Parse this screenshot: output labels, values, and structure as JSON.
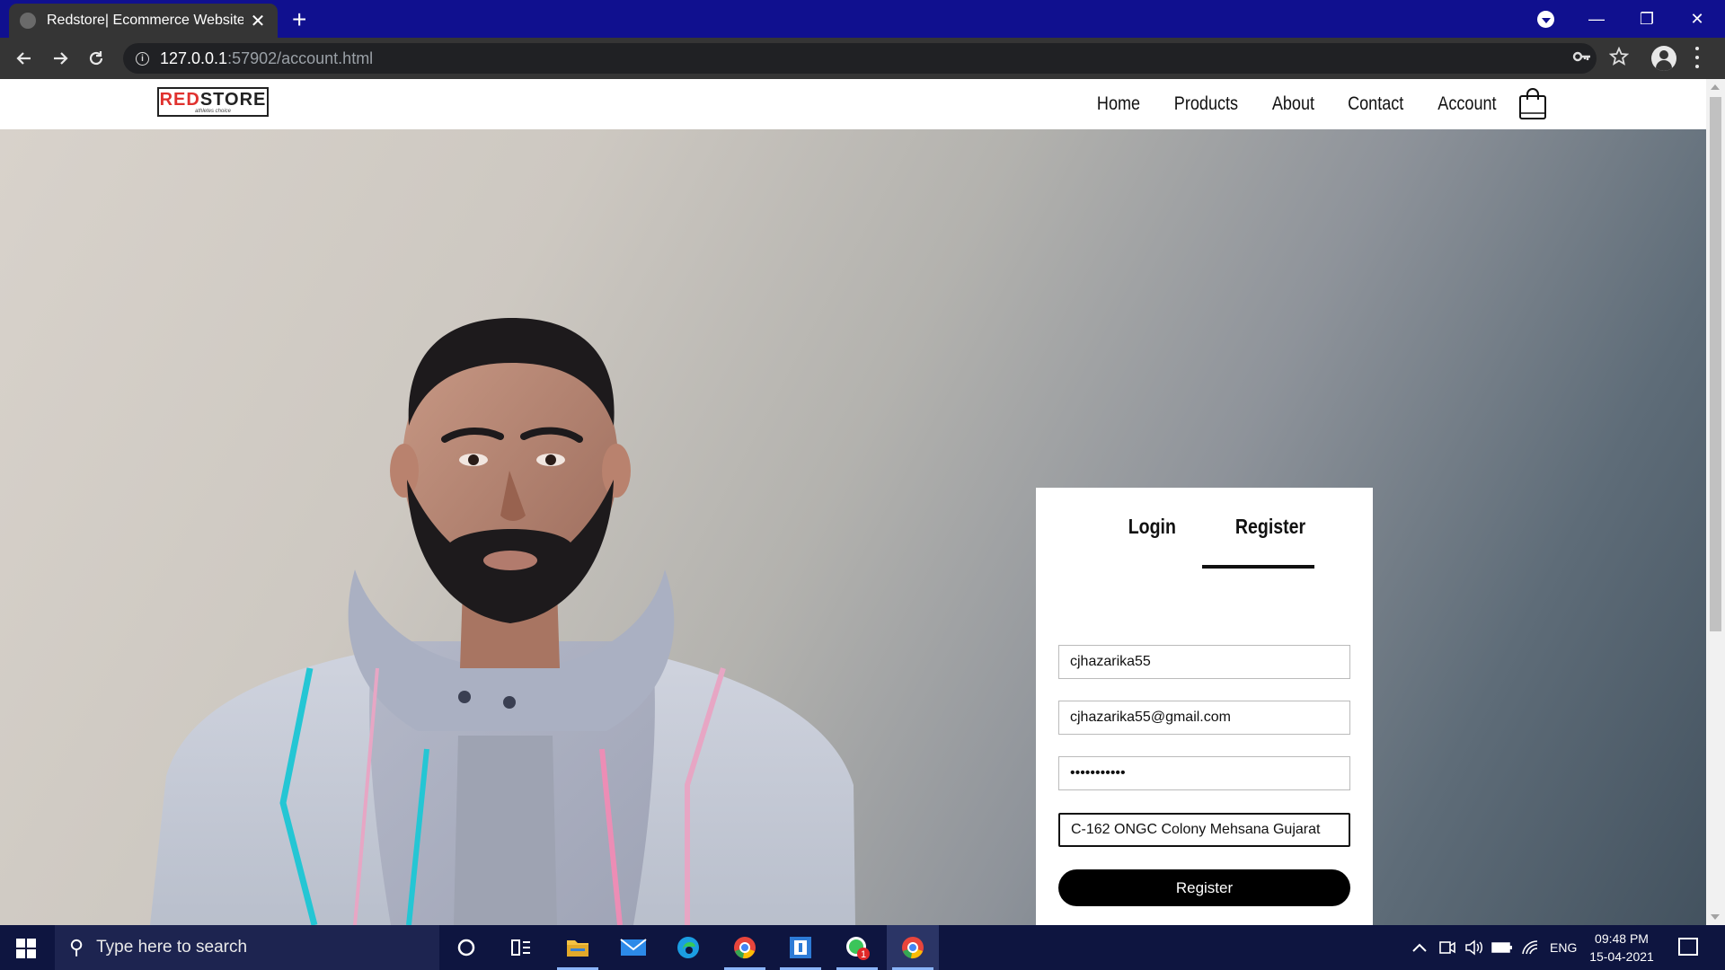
{
  "browser": {
    "tab_title": "Redstore| Ecommerce Website De",
    "tab_close": "✕",
    "new_tab": "+",
    "url_host": "127.0.0.1",
    "url_rest": ":57902/account.html",
    "window_minimize": "—",
    "window_restore": "❐",
    "window_close": "✕"
  },
  "site": {
    "logo_red": "RED",
    "logo_dark": "STORE",
    "logo_tagline": "athletes choice",
    "nav": [
      "Home",
      "Products",
      "About",
      "Contact",
      "Account"
    ]
  },
  "form": {
    "tab_login": "Login",
    "tab_register": "Register",
    "active_tab": "Register",
    "username": "cjhazarika55",
    "email": "cjhazarika55@gmail.com",
    "password_masked": "•••••••••••",
    "address": "C-162 ONGC Colony Mehsana Gujarat",
    "submit": "Register"
  },
  "taskbar": {
    "search_placeholder": "Type here to search",
    "whatsapp_badge": "1",
    "language": "ENG",
    "time": "09:48 PM",
    "date": "15-04-2021"
  }
}
